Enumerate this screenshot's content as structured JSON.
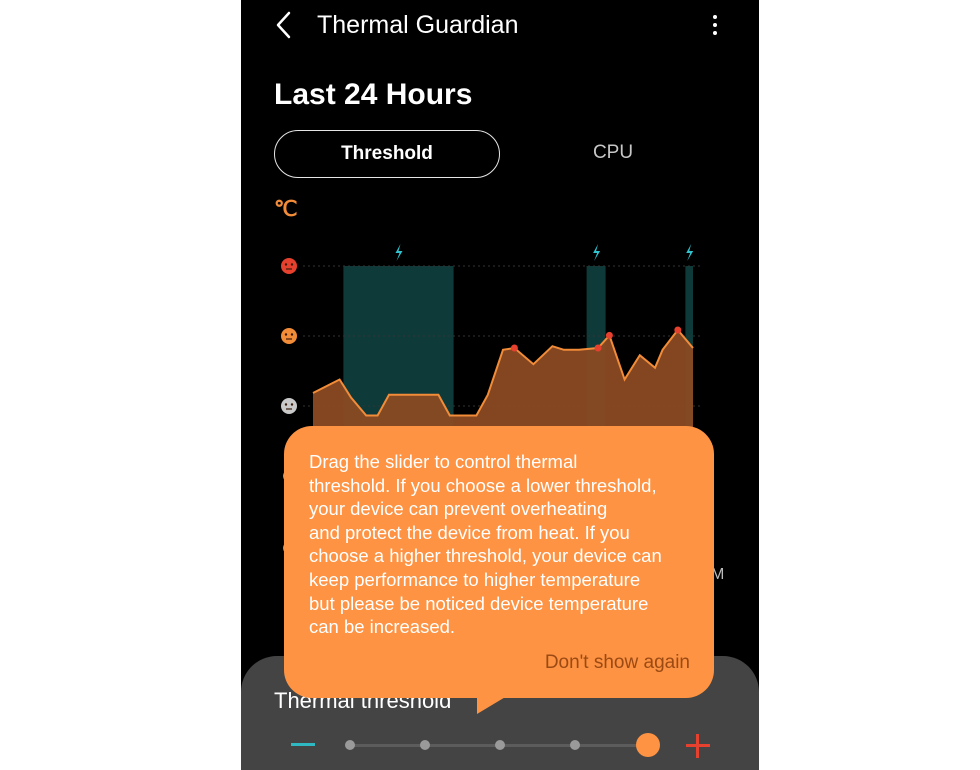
{
  "app": {
    "title": "Thermal Guardian"
  },
  "section": {
    "title": "Last 24 Hours"
  },
  "tabs": [
    {
      "label": "Threshold",
      "active": true
    },
    {
      "label": "CPU",
      "active": false
    }
  ],
  "unit": "℃",
  "chart_data": {
    "type": "area",
    "levels": [
      {
        "name": "hot-face-icon",
        "color": "#e5412e"
      },
      {
        "name": "warm-face-icon",
        "color": "#f28c39"
      },
      {
        "name": "neutral-face-icon",
        "color": "#c9c9c9"
      }
    ],
    "x": [
      0,
      0.07,
      0.1,
      0.14,
      0.17,
      0.2,
      0.33,
      0.36,
      0.43,
      0.46,
      0.5,
      0.53,
      0.58,
      0.63,
      0.66,
      0.7,
      0.75,
      0.78,
      0.82,
      0.86,
      0.9,
      0.92,
      0.96,
      1
    ],
    "values": [
      0.3,
      0.45,
      0.25,
      0.05,
      0.05,
      0.28,
      0.28,
      0.05,
      0.05,
      0.28,
      0.78,
      0.8,
      0.62,
      0.82,
      0.78,
      0.78,
      0.8,
      0.94,
      0.45,
      0.72,
      0.58,
      0.78,
      1.0,
      0.8
    ],
    "charging_bands": [
      [
        0.08,
        0.37
      ],
      [
        0.72,
        0.77
      ],
      [
        0.98,
        1.0
      ]
    ],
    "markers": [
      11,
      16,
      17,
      22
    ],
    "colors": {
      "fill": "#8a4a22",
      "line": "#f28c39",
      "band": "#0f3a3a",
      "marker": "#e5412e",
      "bolt": "#2fc4cf",
      "grid": "#333333"
    }
  },
  "tooltip": {
    "text": "Drag the slider to control thermal\nthreshold. If you choose a lower threshold,\nyour device can prevent overheating\nand protect the device from heat. If you\nchoose a higher threshold, your device can\nkeep performance to higher temperature\nbut please be noticed device temperature\ncan be increased.",
    "dismiss_label": "Don't show again"
  },
  "sheet": {
    "title": "Thermal threshold",
    "peek_label": "M"
  },
  "slider": {
    "stops": 5,
    "value": 5
  }
}
